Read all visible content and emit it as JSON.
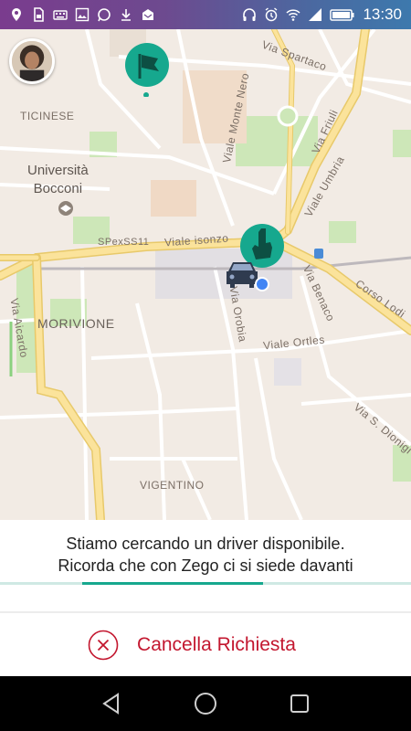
{
  "status_bar": {
    "time": "13:30",
    "left_icons": [
      "location-icon",
      "sim-icon",
      "keyboard-icon",
      "image-icon",
      "whatsapp-icon",
      "download-icon",
      "mail-icon"
    ],
    "right_icons": [
      "headphones-icon",
      "alarm-icon",
      "wifi-icon",
      "signal-icon",
      "battery-icon"
    ]
  },
  "map": {
    "labels": {
      "via_spartaco": "Via Spartaco",
      "viale_monte_nero": "Viale Monte Nero",
      "via_friuli": "Via Friuli",
      "viale_umbria": "Viale Umbria",
      "ticinese": "TICINESE",
      "universita_bocconi_line1": "Università",
      "universita_bocconi_line2": "Bocconi",
      "spexss11": "SPexSS11",
      "viale_isonzo": "Viale isonzo",
      "via_orobia": "Via Orobia",
      "via_benaco": "Via Benaco",
      "corso_lodi": "Corso Lodi",
      "morivione": "MORIVIONE",
      "via_aicardo": "Via Aicardo",
      "viale_ortles": "Viale Ortles",
      "via_s_dionigi": "Via S. Dionigi",
      "vigentino": "VIGENTINO"
    },
    "markers": [
      "flag-marker",
      "hand-marker",
      "car-marker",
      "user-location-dot"
    ]
  },
  "info": {
    "line1": "Stiamo cercando un driver disponibile.",
    "line2": "Ricorda che con Zego ci si siede davanti",
    "progress": 0.44
  },
  "cancel": {
    "label": "Cancella Richiesta"
  },
  "colors": {
    "accent": "#16a88e",
    "cancel": "#c3172f",
    "status_bar_start": "#7a3c8e",
    "status_bar_end": "#3d79ad"
  }
}
